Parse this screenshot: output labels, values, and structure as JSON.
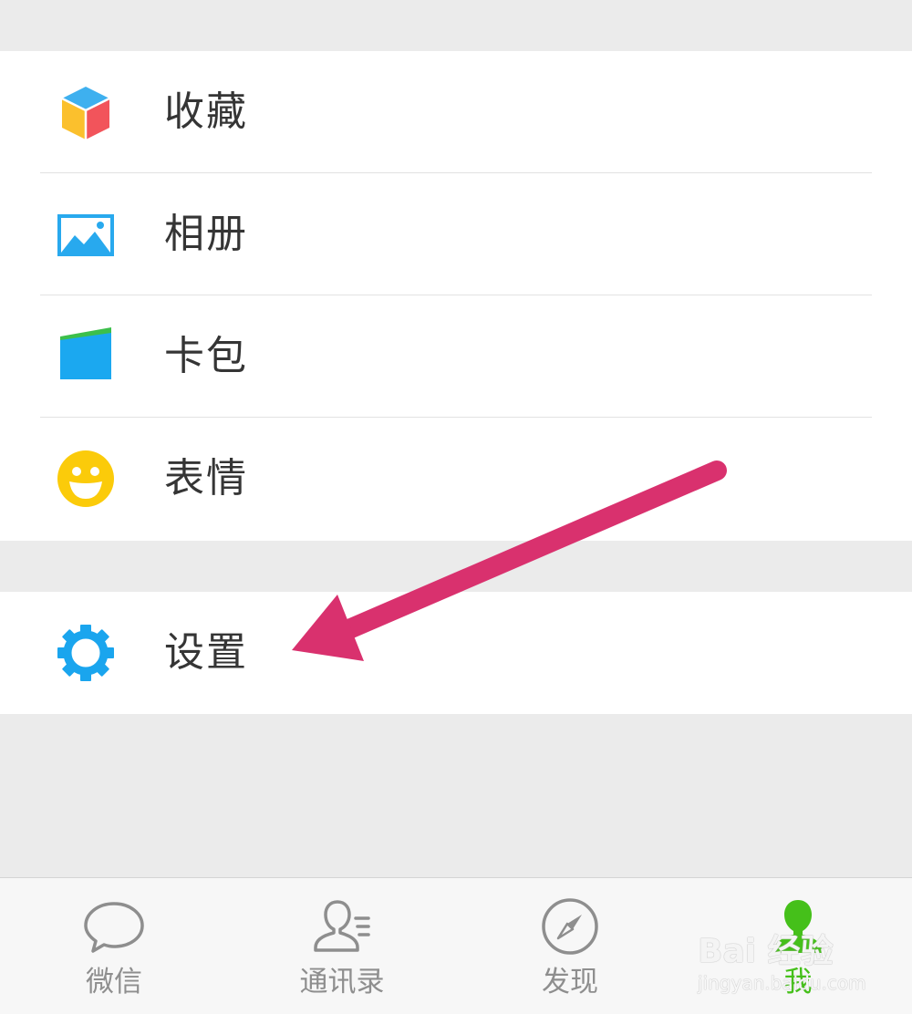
{
  "menu": {
    "group1": [
      {
        "label": "收藏",
        "icon": "favorites-cube-icon"
      },
      {
        "label": "相册",
        "icon": "album-picture-icon"
      },
      {
        "label": "卡包",
        "icon": "card-wallet-icon"
      },
      {
        "label": "表情",
        "icon": "sticker-smiley-icon"
      }
    ],
    "group2": [
      {
        "label": "设置",
        "icon": "gear-icon"
      }
    ]
  },
  "tab_bar": {
    "tabs": [
      {
        "label": "微信",
        "icon": "chat-bubble-icon",
        "active": false
      },
      {
        "label": "通讯录",
        "icon": "contacts-icon",
        "active": false
      },
      {
        "label": "发现",
        "icon": "compass-icon",
        "active": false
      },
      {
        "label": "我",
        "icon": "me-person-icon",
        "active": true
      }
    ]
  },
  "annotation": {
    "arrow_color": "#d9316e",
    "points_to": "设置"
  },
  "watermark": {
    "brand": "Bai 经验",
    "url": "jingyan.baidu.com"
  },
  "colors": {
    "background": "#ebebeb",
    "active_tab": "#45c01a",
    "inactive_tab": "#8e8e8e",
    "gear_icon": "#1aa5ee"
  }
}
